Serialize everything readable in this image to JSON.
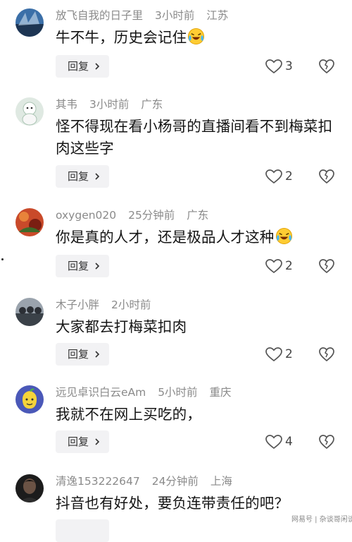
{
  "reply_label": "回复",
  "comments": [
    {
      "user": "放飞自我的日子里",
      "time": "3小时前",
      "location": "江苏",
      "text": "牛不牛，历史会记住",
      "emoji": true,
      "likes": "3"
    },
    {
      "user": "其韦",
      "time": "3小时前",
      "location": "广东",
      "text": "怪不得现在看小杨哥的直播间看不到梅菜扣肉这些字",
      "emoji": false,
      "likes": "2"
    },
    {
      "user": "oxygen020",
      "time": "25分钟前",
      "location": "广东",
      "text": "你是真的人才，还是极品人才这种",
      "emoji": true,
      "likes": "2"
    },
    {
      "user": "木子小胖",
      "time": "2小时前",
      "location": "",
      "text": "大家都去打梅菜扣肉",
      "emoji": false,
      "likes": "2"
    },
    {
      "user": "远见卓识白云eAm",
      "time": "5小时前",
      "location": "重庆",
      "text": "我就不在网上买吃的，",
      "emoji": false,
      "likes": "4"
    },
    {
      "user": "清逸153222647",
      "time": "24分钟前",
      "location": "上海",
      "text": "抖音也有好处，要负连带责任的吧？",
      "emoji": false,
      "likes": ""
    }
  ],
  "watermark": "网易号 | 杂谈哥闲谈"
}
